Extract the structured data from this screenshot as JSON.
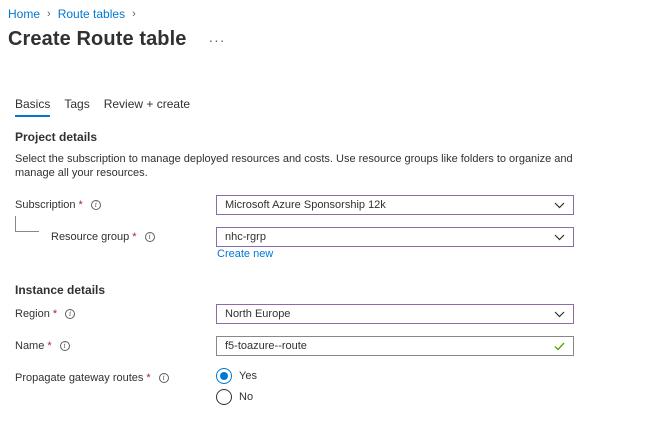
{
  "breadcrumb": {
    "items": [
      {
        "label": "Home"
      },
      {
        "label": "Route tables"
      }
    ]
  },
  "header": {
    "title": "Create Route table",
    "more_label": "···"
  },
  "tabs": [
    {
      "label": "Basics",
      "active": true
    },
    {
      "label": "Tags",
      "active": false
    },
    {
      "label": "Review + create",
      "active": false
    }
  ],
  "project_details": {
    "title": "Project details",
    "description": "Select the subscription to manage deployed resources and costs. Use resource groups like folders to organize and manage all your resources.",
    "subscription": {
      "label": "Subscription",
      "required": "*",
      "value": "Microsoft Azure Sponsorship 12k"
    },
    "resource_group": {
      "label": "Resource group",
      "required": "*",
      "value": "nhc-rgrp",
      "create_new": "Create new"
    }
  },
  "instance_details": {
    "title": "Instance details",
    "region": {
      "label": "Region",
      "required": "*",
      "value": "North Europe"
    },
    "name": {
      "label": "Name",
      "required": "*",
      "value": "f5-toazure--route"
    },
    "propagate": {
      "label": "Propagate gateway routes",
      "required": "*",
      "options": [
        {
          "label": "Yes",
          "selected": true
        },
        {
          "label": "No",
          "selected": false
        }
      ]
    }
  },
  "colors": {
    "accent": "#0078d4",
    "required": "#a4262c",
    "valid_check": "#57a300",
    "field_border": "#8a6da8"
  }
}
